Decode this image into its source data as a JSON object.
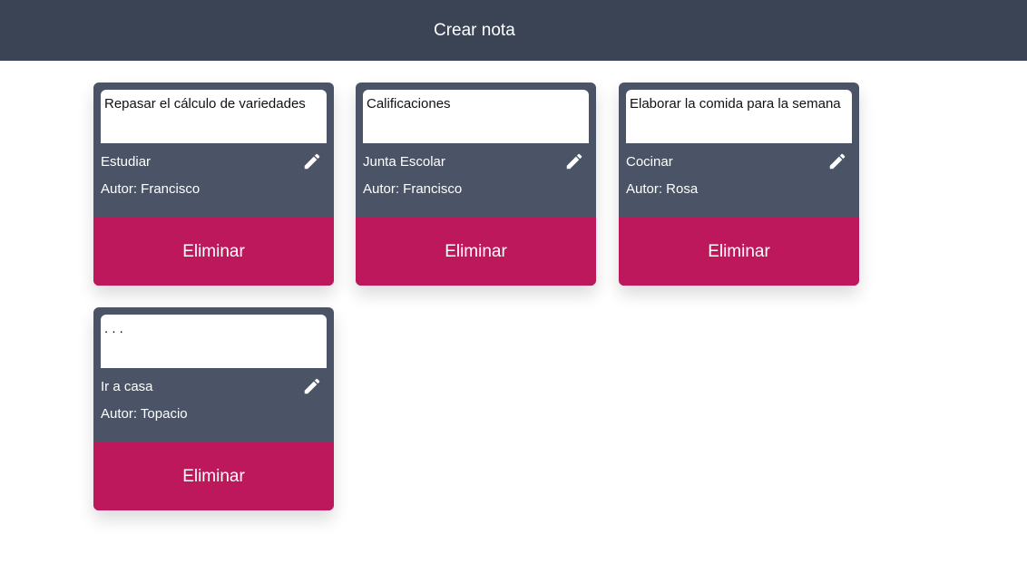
{
  "header": {
    "create_label": "Crear nota"
  },
  "notes": [
    {
      "body": "Repasar el cálculo de variedades",
      "title": "Estudiar",
      "author": "Autor: Francisco",
      "delete_label": "Eliminar"
    },
    {
      "body": "Calificaciones",
      "title": "Junta Escolar",
      "author": "Autor: Francisco",
      "delete_label": "Eliminar"
    },
    {
      "body": "Elaborar la comida para la semana",
      "title": "Cocinar",
      "author": "Autor: Rosa",
      "delete_label": "Eliminar"
    },
    {
      "body": ". . .",
      "title": "Ir a casa",
      "author": "Autor: Topacio",
      "delete_label": "Eliminar"
    }
  ],
  "colors": {
    "header_bg": "#3b4455",
    "card_bg": "#4a5466",
    "delete_bg": "#be185d"
  },
  "icons": {
    "edit": "pencil-icon"
  }
}
